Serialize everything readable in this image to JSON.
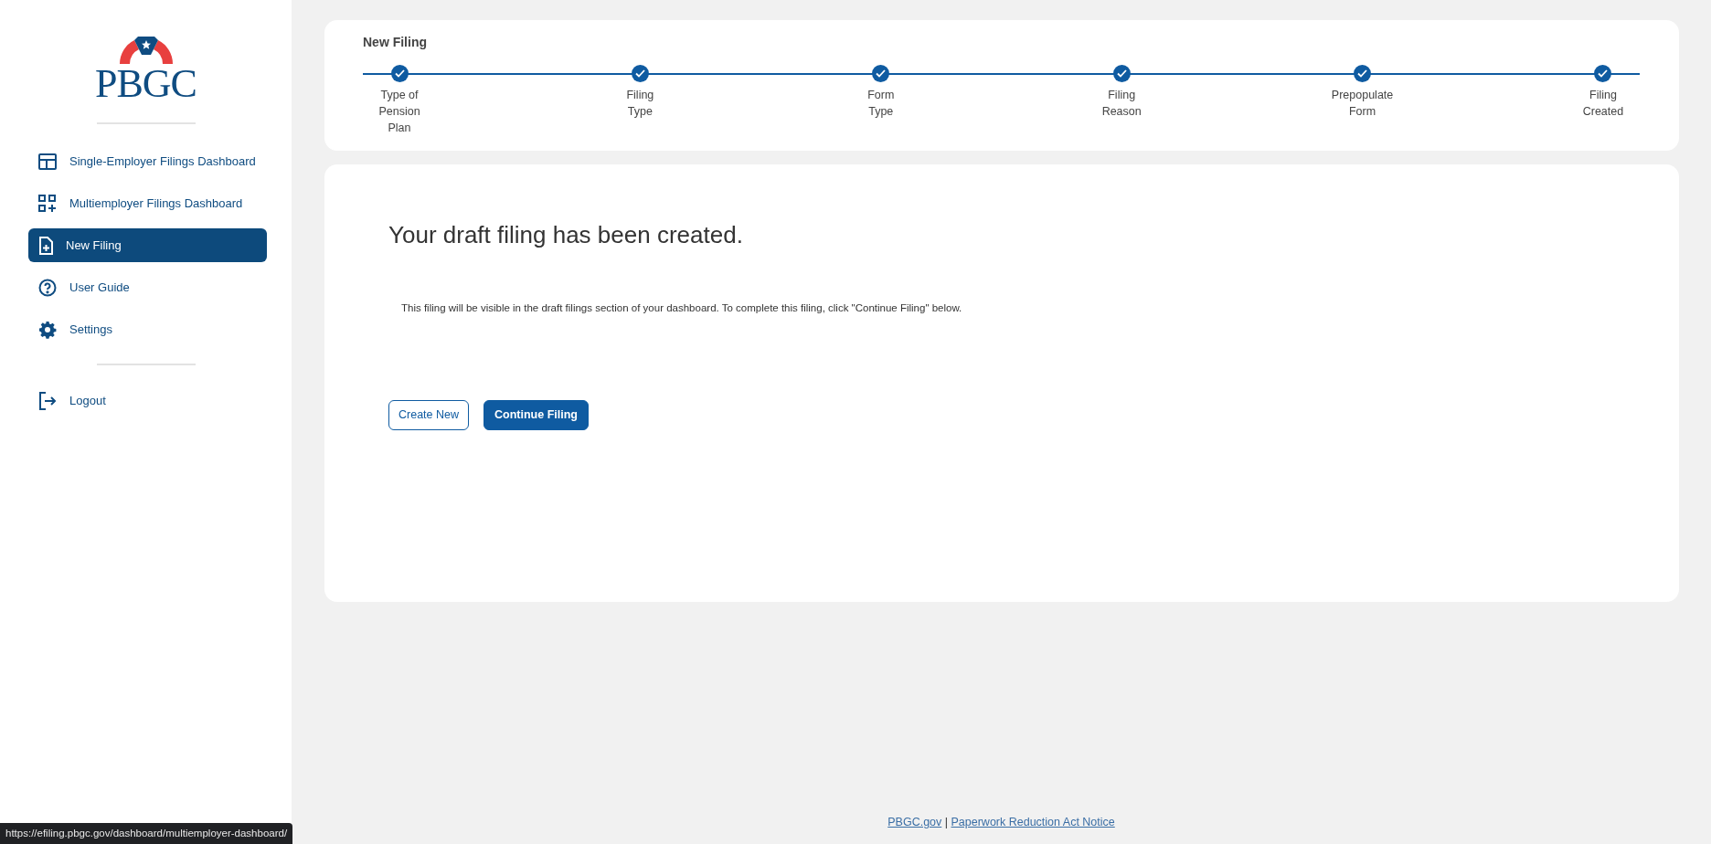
{
  "logo": {
    "text": "PBGC"
  },
  "sidebar": {
    "items": [
      {
        "label": "Single-Employer Filings Dashboard",
        "kind": "layout",
        "selected": false
      },
      {
        "label": "Multiemployer Filings Dashboard",
        "kind": "grid",
        "selected": false
      },
      {
        "label": "New Filing",
        "kind": "file",
        "selected": true
      },
      {
        "label": "User Guide",
        "kind": "help",
        "selected": false
      },
      {
        "label": "Settings",
        "kind": "settings",
        "selected": false
      },
      {
        "label": "Logout",
        "kind": "logout",
        "selected": false,
        "divider_before": true
      }
    ]
  },
  "stepper": {
    "title": "New Filing",
    "steps": [
      {
        "label_lines": [
          "Type of",
          "Pension",
          "Plan"
        ],
        "completed": true
      },
      {
        "label_lines": [
          "Filing",
          "Type"
        ],
        "completed": true
      },
      {
        "label_lines": [
          "Form",
          "Type"
        ],
        "completed": true
      },
      {
        "label_lines": [
          "Filing",
          "Reason"
        ],
        "completed": true
      },
      {
        "label_lines": [
          "Prepopulate",
          "Form"
        ],
        "completed": true
      },
      {
        "label_lines": [
          "Filing",
          "Created"
        ],
        "completed": true
      }
    ]
  },
  "main": {
    "heading": "Your draft filing has been created.",
    "message": "This filing will be visible in the draft filings section of your dashboard. To complete this filing, click \"Continue Filing\" below.",
    "buttons": [
      {
        "label": "Create New",
        "kind": "outline"
      },
      {
        "label": "Continue Filing",
        "kind": "primary"
      }
    ]
  },
  "footer": {
    "links": [
      "PBGC.gov",
      "Paperwork Reduction Act Notice"
    ],
    "separator": "|"
  },
  "status_url": "https://efiling.pbgc.gov/dashboard/multiemployer-dashboard/"
}
